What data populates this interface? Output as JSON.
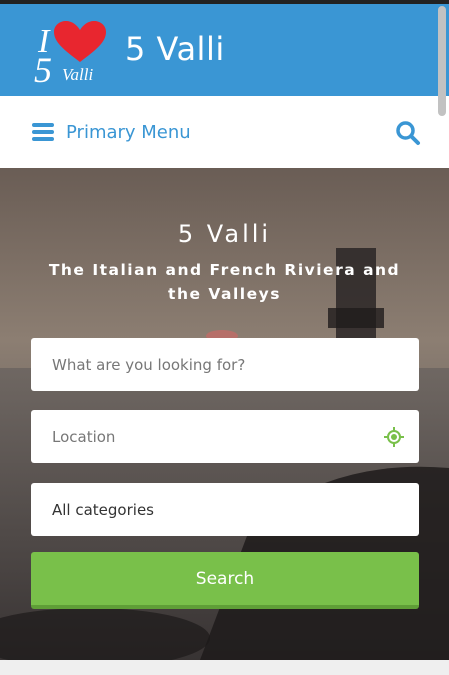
{
  "header": {
    "site_title": "5 Valli",
    "logo": {
      "line1": "I",
      "number": "5",
      "word": "Valli",
      "heart_color": "#e8262f",
      "text_color": "#ffffff"
    },
    "background": "#3a96d4"
  },
  "menubar": {
    "menu_label": "Primary Menu",
    "accent": "#3a96d4"
  },
  "hero": {
    "title": "5 Valli",
    "subtitle": "The Italian and French Riviera and the Valleys",
    "search": {
      "what_placeholder": "What are you looking for?",
      "location_placeholder": "Location",
      "category_selected": "All categories",
      "button_label": "Search",
      "button_color": "#79c04a"
    }
  }
}
